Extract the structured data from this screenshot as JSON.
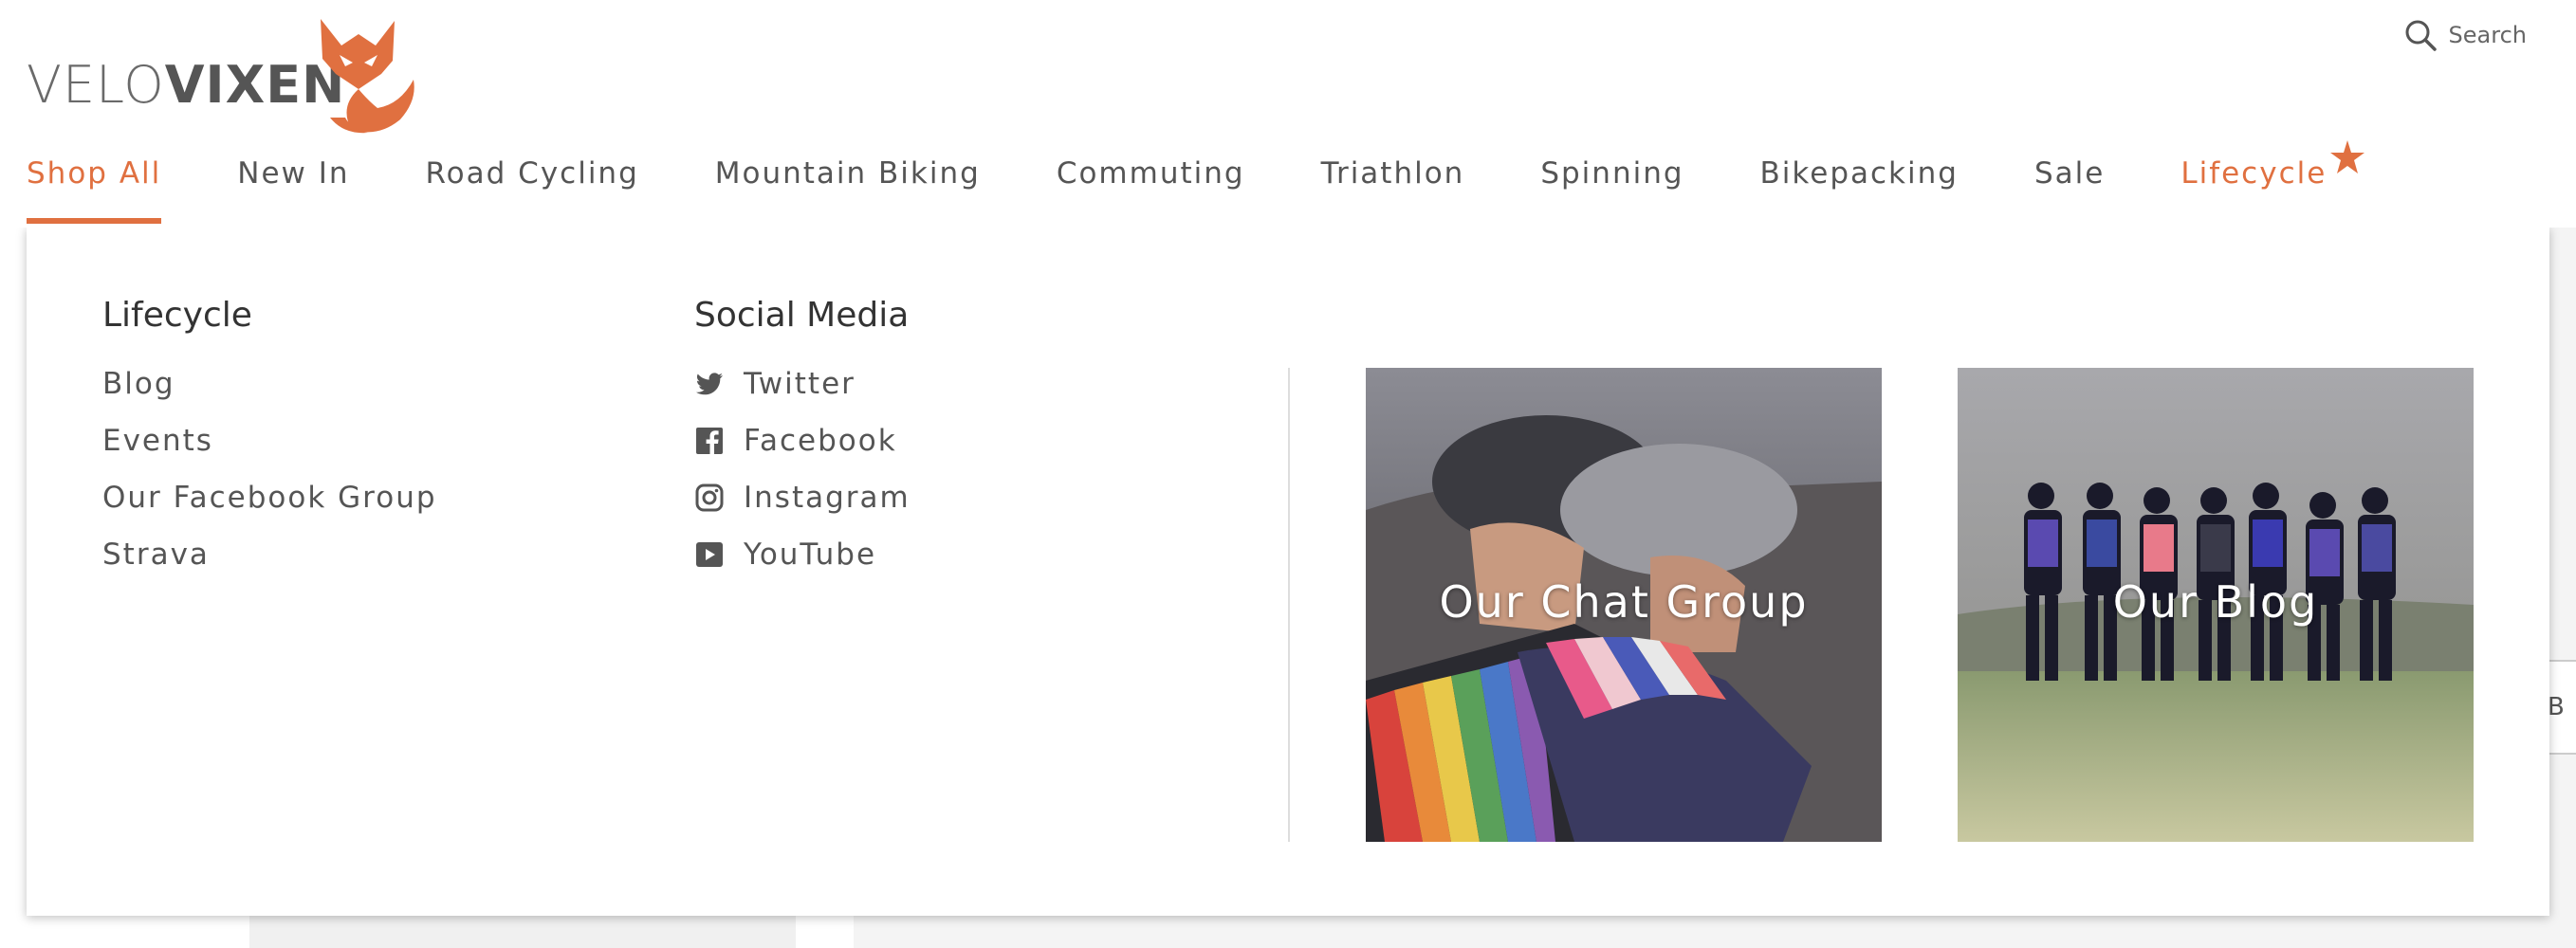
{
  "header": {
    "logo": {
      "part1": "VELO",
      "part2": "VIXEN"
    },
    "search_label": "Search"
  },
  "nav": [
    {
      "label": "Shop All",
      "active": true
    },
    {
      "label": "New In"
    },
    {
      "label": "Road Cycling"
    },
    {
      "label": "Mountain Biking"
    },
    {
      "label": "Commuting"
    },
    {
      "label": "Triathlon"
    },
    {
      "label": "Spinning"
    },
    {
      "label": "Bikepacking"
    },
    {
      "label": "Sale"
    },
    {
      "label": "Lifecycle",
      "icon": "star-icon"
    }
  ],
  "dropdown": {
    "lifecycle": {
      "title": "Lifecycle",
      "links": [
        "Blog",
        "Events",
        "Our Facebook Group",
        "Strava"
      ]
    },
    "social": {
      "title": "Social Media",
      "links": [
        {
          "label": "Twitter",
          "icon": "twitter-icon"
        },
        {
          "label": "Facebook",
          "icon": "facebook-icon"
        },
        {
          "label": "Instagram",
          "icon": "instagram-icon"
        },
        {
          "label": "YouTube",
          "icon": "youtube-icon"
        }
      ]
    },
    "cards": [
      {
        "label": "Our Chat Group"
      },
      {
        "label": "Our Blog"
      }
    ]
  },
  "colors": {
    "accent": "#e07040",
    "text": "#555555"
  }
}
